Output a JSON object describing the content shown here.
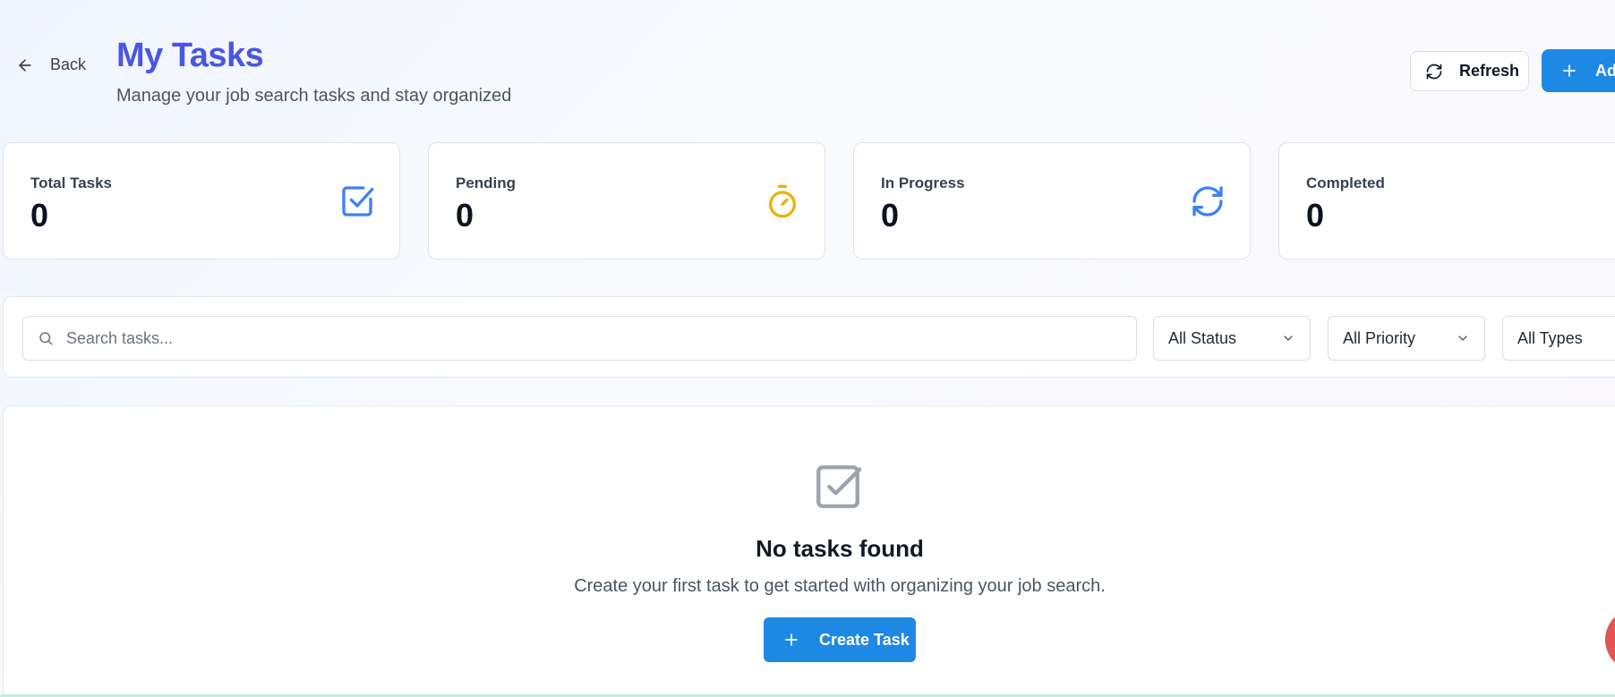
{
  "header": {
    "back_label": "Back",
    "title": "My Tasks",
    "subtitle": "Manage your job search tasks and stay organized",
    "refresh_label": "Refresh",
    "add_label": "Ad"
  },
  "stats": [
    {
      "label": "Total Tasks",
      "value": "0",
      "icon": "checkbox-icon",
      "color": "#3b82f6"
    },
    {
      "label": "Pending",
      "value": "0",
      "icon": "stopwatch-icon",
      "color": "#eab308"
    },
    {
      "label": "In Progress",
      "value": "0",
      "icon": "refresh-icon",
      "color": "#3b82f6"
    },
    {
      "label": "Completed",
      "value": "0",
      "icon": "check-circle-icon",
      "color": "#16a34a"
    }
  ],
  "filters": {
    "search_placeholder": "Search tasks...",
    "status": "All Status",
    "priority": "All Priority",
    "type": "All Types"
  },
  "empty_state": {
    "icon": "checkbox-icon",
    "title": "No tasks found",
    "description": "Create your first task to get started with organizing your job search.",
    "button_label": "Create Task"
  },
  "colors": {
    "title": "#4a56e2",
    "primary_button": "#1e88e5",
    "fab": "#e25555"
  }
}
